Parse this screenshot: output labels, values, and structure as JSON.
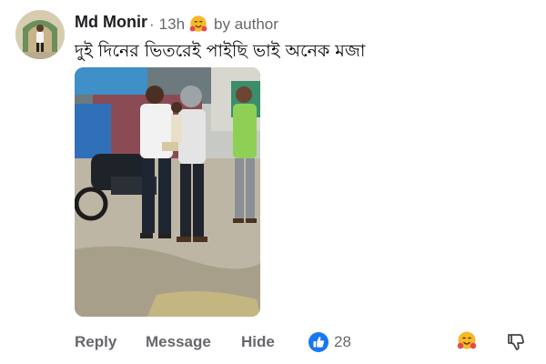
{
  "comment": {
    "author": "Md Monir",
    "time": "13h",
    "separator": "·",
    "badge_icon": "hugging-emoji-icon",
    "badge_label": "by author",
    "text": "দুই দিনের ভিতরেই পাইছি ভাই অনেক মজা"
  },
  "actions": {
    "reply": "Reply",
    "message": "Message",
    "hide": "Hide",
    "like_icon": "thumbs-up-icon",
    "like_count": "28",
    "reaction_icon": "hugging-emoji-icon",
    "dislike_icon": "thumbs-down-icon"
  },
  "colors": {
    "like_blue": "#1877f2",
    "muted_text": "#65676b",
    "emoji_yellow": "#f7b928",
    "emoji_red": "#e8474d"
  }
}
